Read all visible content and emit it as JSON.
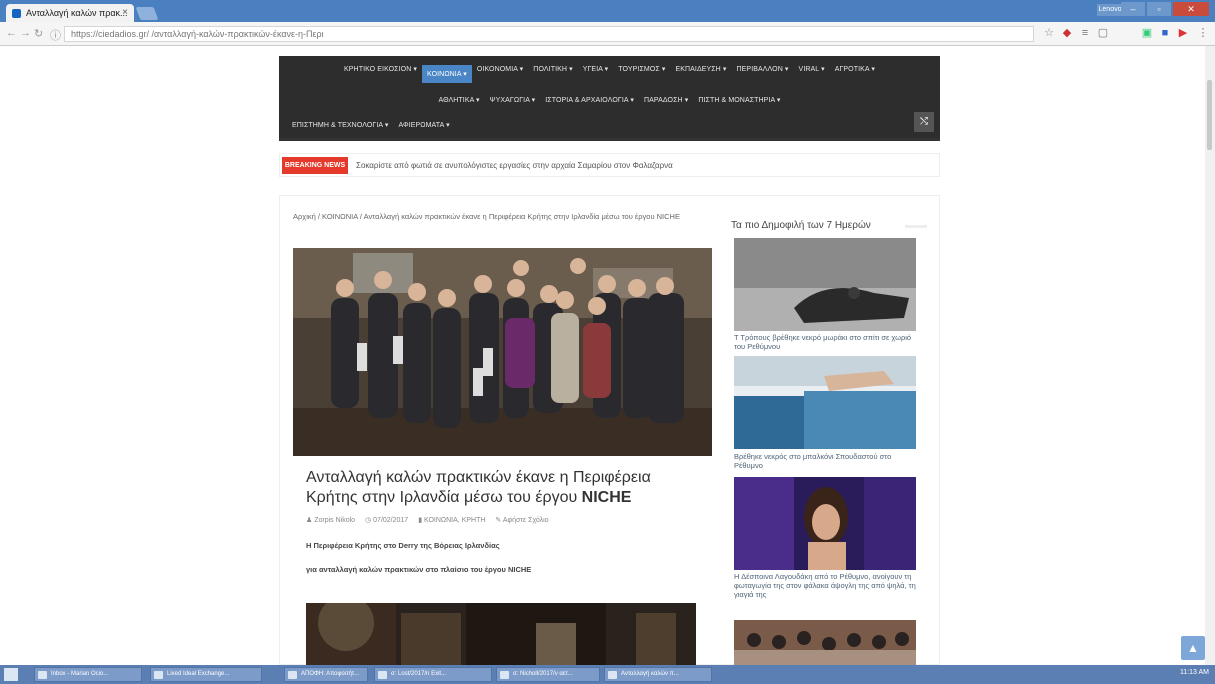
{
  "browser": {
    "tab_title": "Ανταλλαγή καλών πρακ...",
    "tab_close": "×",
    "profile_label": "Lenovo",
    "win_min": "–",
    "win_max": "▫",
    "win_close": "✕",
    "url": "https://ciedadios.gr/ /ανταλλαγή-καλών-πρακτικών-έκανε-η-Περι",
    "ext_icons": [
      "star-icon",
      "extension-icon",
      "menu-icon",
      "download-icon",
      "bookmark-icon",
      "extension2-icon",
      "youtube-icon"
    ]
  },
  "nav": {
    "row1": [
      "ΚΡΗΤΙΚΟ ΕΙΚΟΣΙΟΝ ▾",
      "ΚΟΙΝΩΝΙΑ ▾",
      "ΟΙΚΟΝΟΜΙΑ ▾",
      "ΠΟΛΙΤΙΚΗ ▾",
      "ΥΓΕΙΑ ▾",
      "ΤΟΥΡΙΣΜΟΣ ▾",
      "ΕΚΠΑΙΔΕΥΣΗ ▾",
      "ΠΕΡΙΒΑΛΛΟΝ ▾",
      "VIRAL ▾",
      "ΑΓΡΟΤΙΚΑ ▾"
    ],
    "row1_active_index": 1,
    "row2": [
      "ΑΘΛΗΤΙΚΑ ▾",
      "ΨΥΧΑΓΩΓΙΑ ▾",
      "ΙΣΤΟΡΙΑ & ΑΡΧΑΙΟΛΟΓΙΑ ▾",
      "ΠΑΡΑΔΟΣΗ ▾",
      "ΠΙΣΤΗ & ΜΟΝΑΣΤΗΡΙΑ ▾"
    ],
    "row3": [
      "ΕΠΙΣΤΗΜΗ & ΤΕΧΝΟΛΟΓΙΑ ▾",
      "ΑΦΙΕΡΩΜΑΤΑ ▾"
    ],
    "shuffle_icon": "⤭"
  },
  "breaking": {
    "label": "BREAKING NEWS",
    "text": "Σοκαρίστε από φωτιά σε ανυπολόγιστες εργασίες στην αρχαία Σαμαρίου στον Φαλαζαρνα"
  },
  "breadcrumb": "Αρχική / ΚΟΙΝΩΝΙΑ / Ανταλλαγή καλών πρακτικών έκανε η Περιφέρεια Κρήτης στην Ιρλανδία μέσω του έργου NICHE",
  "article": {
    "title_main": "Ανταλλαγή καλών πρακτικών έκανε η Περιφέρεια Κρήτης στην Ιρλανδία μέσω του έργου ",
    "title_bold": "NICHE",
    "author": "Zorpis Nikolo",
    "date": "07/02/2017",
    "categories": "ΚΟΙΝΩΝΙΑ, ΚΡΗΤΗ",
    "comments": "Αφήστε Σχόλιο",
    "para1": "Η Περιφέρεια Κρήτης στο Derry της Βόρειας Ιρλανδίας",
    "para2": "για ανταλλαγή καλών πρακτικών στο πλαίσιο του έργου NICHE"
  },
  "sidebar": {
    "title": "Τα πιο Δημοφιλή των 7 Ημερών",
    "items": [
      {
        "caption": "Τ Τρόπους βρέθηκε νεκρό μωράκι στο σπίτι σε χωριό του Ρεθύμνου"
      },
      {
        "caption": "Βρέθηκε νεκρός στο μπαλκόνι Σπουδαστού στο Ρέθυμνο"
      },
      {
        "caption": "Η Δέσποινα Λαγουδάκη από το Ρέθυμνο, ανοίγουν τη φωταγωγία της στον φάλακα άψογλη της από ψηλά, τη γιαγιά της"
      },
      {
        "caption": ""
      }
    ]
  },
  "taskbar": {
    "items": [
      "Inbox - Marian Ocio...",
      "Lixed Ideal Exchange...",
      "ΑΠΟΦΗ: Αποφοιτήτ...",
      "σ: Lost/2017/n Exit...",
      "σ: Nicholl/2017/ν αετ...",
      "Ανταλλαγή καλών π..."
    ],
    "tray": "11:13 AM"
  },
  "fab_icon": "▲"
}
